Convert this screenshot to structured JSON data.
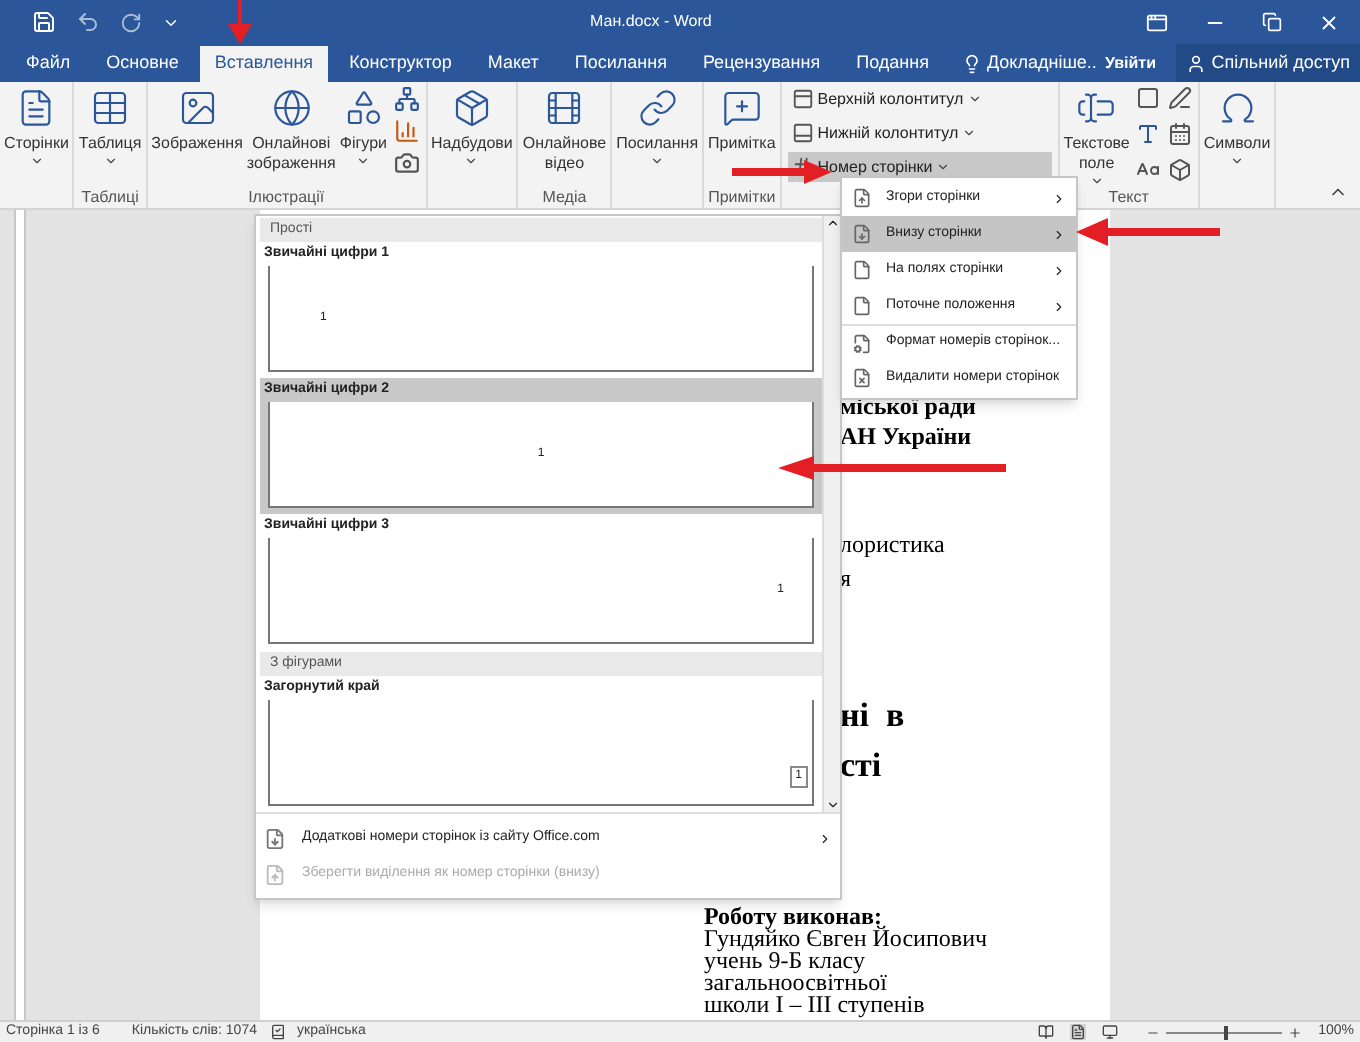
{
  "window": {
    "title": "Ман.docx - Word"
  },
  "tabs": [
    {
      "label": "Файл",
      "selected": false
    },
    {
      "label": "Основне",
      "selected": false
    },
    {
      "label": "Вставлення",
      "selected": true
    },
    {
      "label": "Конструктор",
      "selected": false
    },
    {
      "label": "Макет",
      "selected": false
    },
    {
      "label": "Посилання",
      "selected": false
    },
    {
      "label": "Рецензування",
      "selected": false
    },
    {
      "label": "Подання",
      "selected": false
    }
  ],
  "tell_me": "Докладніше..",
  "sign_in": "Увійти",
  "share": "Спільний доступ",
  "ribbon_groups": [
    {
      "buttons": [
        {
          "label": "Сторінки",
          "kind": "pages",
          "dropdown": true
        }
      ]
    },
    {
      "label": "Таблиці",
      "buttons": [
        {
          "label": "Таблиця",
          "kind": "table",
          "dropdown": true
        }
      ]
    },
    {
      "label": "Ілюстрації",
      "buttons": [
        {
          "label": "Зображення",
          "kind": "picture",
          "dropdown": false
        },
        {
          "label": "Онлайнові зображення",
          "kind": "online",
          "dropdown": false
        },
        {
          "label": "Фігури",
          "kind": "shapes",
          "dropdown": true
        },
        {
          "kind": "illustration_smalls"
        }
      ]
    },
    {
      "buttons": [
        {
          "label": "Надбудови",
          "kind": "addins",
          "dropdown": true
        }
      ]
    },
    {
      "label": "Медіа",
      "buttons": [
        {
          "label": "Онлайнове відео",
          "kind": "video",
          "dropdown": false
        }
      ]
    },
    {
      "buttons": [
        {
          "label": "Посилання",
          "kind": "links",
          "dropdown": true
        }
      ]
    },
    {
      "label": "Примітки",
      "buttons": [
        {
          "label": "Примітка",
          "kind": "comment",
          "dropdown": false
        }
      ]
    },
    {
      "buttons": [
        {
          "kind": "header_footer",
          "items": [
            {
              "label": "Верхній колонтитул",
              "selected": false
            },
            {
              "label": "Нижній колонтитул",
              "selected": false
            },
            {
              "label": "Номер сторінки",
              "selected": true
            }
          ]
        }
      ]
    },
    {
      "label": "Текст",
      "buttons": [
        {
          "label": "Текстове поле",
          "kind": "textbox",
          "dropdown": true
        },
        {
          "kind": "text_smalls"
        }
      ]
    },
    {
      "buttons": [
        {
          "label": "Символи",
          "kind": "symbols",
          "dropdown": true
        }
      ]
    }
  ],
  "page_number_menu": [
    {
      "label": "Згори сторінки",
      "selected": false,
      "submenu": true
    },
    {
      "label": "Внизу сторінки",
      "selected": true,
      "submenu": true
    },
    {
      "label": "На полях сторінки",
      "selected": false,
      "submenu": true
    },
    {
      "label": "Поточне положення",
      "selected": false,
      "submenu": true
    },
    {
      "label": "Формат номерів сторінок...",
      "selected": false,
      "submenu": false
    },
    {
      "label": "Видалити номери сторінок",
      "selected": false,
      "submenu": false
    }
  ],
  "gallery": {
    "sections": [
      {
        "title": "Прості",
        "items": [
          {
            "label": "Звичайні цифри 1",
            "kind": "left",
            "number": "1",
            "selected": false
          },
          {
            "label": "Звичайні цифри 2",
            "kind": "center",
            "number": "1",
            "selected": true
          },
          {
            "label": "Звичайні цифри 3",
            "kind": "right",
            "number": "1",
            "selected": false
          }
        ]
      },
      {
        "title": "З фігурами",
        "items": [
          {
            "label": "Загорнутий край",
            "kind": "corner",
            "number": "1",
            "selected": false
          }
        ]
      }
    ],
    "footer_items": [
      {
        "label": "Додаткові номери сторінок із сайту Office.com",
        "disabled": false,
        "submenu": true
      },
      {
        "label": "Зберегти виділення як номер сторінки (внизу)",
        "disabled": true,
        "submenu": false
      }
    ]
  },
  "document": {
    "title_fragments": [
      {
        "text": "міської ради",
        "kind": "bold"
      },
      {
        "text": "АН України",
        "kind": "bold"
      },
      {
        "text": "лористика",
        "kind": "plain"
      },
      {
        "text": "я",
        "kind": "plain"
      },
      {
        "text": "ні  в",
        "kind": "large"
      },
      {
        "text": "сті",
        "kind": "large"
      }
    ],
    "signature": [
      {
        "text": "Роботу виконав:",
        "kind": "bold"
      },
      {
        "text": "Гундяйко Євген Йосипович",
        "kind": "plain"
      },
      {
        "text": "учень 9-Б класу",
        "kind": "plain"
      },
      {
        "text": "загальноосвітньої",
        "kind": "plain"
      },
      {
        "text": "школи І – ІІІ ступенів",
        "kind": "plain"
      }
    ]
  },
  "status_bar": {
    "page": "Сторінка 1 із 6",
    "words": "Кількість слів: 1074",
    "language": "українська",
    "zoom": {
      "level": 0.5,
      "reading": "100%"
    }
  }
}
